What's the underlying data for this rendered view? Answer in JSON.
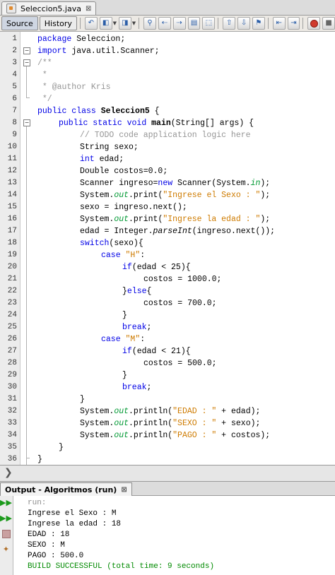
{
  "editor_tab": {
    "title": "Seleccion5.java",
    "close": "⊠"
  },
  "toolbar": {
    "source_label": "Source",
    "history_label": "History"
  },
  "line_numbers": [
    "1",
    "2",
    "3",
    "4",
    "5",
    "6",
    "7",
    "8",
    "9",
    "10",
    "11",
    "12",
    "13",
    "14",
    "15",
    "16",
    "17",
    "18",
    "19",
    "20",
    "21",
    "22",
    "23",
    "24",
    "25",
    "26",
    "27",
    "28",
    "29",
    "30",
    "31",
    "32",
    "33",
    "34",
    "35",
    "36"
  ],
  "code": {
    "l1": {
      "kw": "package",
      "rest": " Seleccion;"
    },
    "l2": {
      "kw": "import",
      "rest": " java.util.Scanner;"
    },
    "l3": "/**",
    "l4": " *",
    "l5": " * @author Kris",
    "l6": " */",
    "l7": {
      "kw": "public class",
      "sp": " ",
      "name": "Seleccion5",
      "rest": " {"
    },
    "l8": {
      "kw": "public static void",
      "sp": " ",
      "name": "main",
      "rest": "(String[] args) {"
    },
    "l9": "// TODO code application logic here",
    "l10": "String sexo;",
    "l11": {
      "kw": "int",
      "rest": " edad;"
    },
    "l12": "Double costos=0.0;",
    "l13": {
      "a": "Scanner ingreso=",
      "kw": "new",
      "b": " Scanner(System.",
      "fld": "in",
      "c": ");"
    },
    "l14": {
      "a": "System.",
      "fld": "out",
      "b": ".print(",
      "str": "\"Ingrese el Sexo : \"",
      "c": ");"
    },
    "l15": "sexo = ingreso.next();",
    "l16": {
      "a": "System.",
      "fld": "out",
      "b": ".print(",
      "str": "\"Ingrese la edad : \"",
      "c": ");"
    },
    "l17": {
      "a": "edad = Integer.",
      "it": "parseInt",
      "b": "(ingreso.next());"
    },
    "l18": {
      "kw": "switch",
      "rest": "(sexo){"
    },
    "l19": {
      "kw": "case",
      "sp": " ",
      "str": "\"H\"",
      "rest": ":"
    },
    "l20": {
      "kw": "if",
      "rest": "(edad < 25){"
    },
    "l21": "costos = 1000.0;",
    "l22": {
      "a": "}",
      "kw": "else",
      "b": "{"
    },
    "l23": "costos = 700.0;",
    "l24": "}",
    "l25": {
      "kw": "break",
      "rest": ";"
    },
    "l26": {
      "kw": "case",
      "sp": " ",
      "str": "\"M\"",
      "rest": ":"
    },
    "l27": {
      "kw": "if",
      "rest": "(edad < 21){"
    },
    "l28": "costos = 500.0;",
    "l29": "}",
    "l30": {
      "kw": "break",
      "rest": ";"
    },
    "l31": "}",
    "l32": {
      "a": "System.",
      "fld": "out",
      "b": ".println(",
      "str": "\"EDAD : \"",
      "c": " + edad);"
    },
    "l33": {
      "a": "System.",
      "fld": "out",
      "b": ".println(",
      "str": "\"SEXO : \"",
      "c": " + sexo);"
    },
    "l34": {
      "a": "System.",
      "fld": "out",
      "b": ".println(",
      "str": "\"PAGO : \"",
      "c": " + costos);"
    },
    "l35": "}",
    "l36": "}"
  },
  "output_panel": {
    "title": "Output - Algoritmos (run)",
    "close": "⊠",
    "lines": [
      "run:",
      "Ingrese el Sexo : M",
      "Ingrese la edad : 18",
      "EDAD : 18",
      "SEXO : M",
      "PAGO : 500.0",
      "BUILD SUCCESSFUL (total time: 9 seconds)"
    ]
  },
  "colors": {
    "keyword": "#0000e6",
    "string": "#ce7b00",
    "comment": "#969696",
    "field": "#009933",
    "build_success": "#008a00"
  },
  "icons": [
    "java-file-icon",
    "close-icon",
    "last-edit-icon",
    "back-icon",
    "forward-icon",
    "find-icon",
    "find-previous-icon",
    "find-next-icon",
    "find-selection-icon",
    "toggle-highlight-icon",
    "toggle-rectangular-icon",
    "previous-bookmark-icon",
    "next-bookmark-icon",
    "toggle-bookmark-icon",
    "shift-left-icon",
    "shift-right-icon",
    "start-macro-icon",
    "stop-macro-icon",
    "navigator-chevron-icon",
    "rerun-icon",
    "rerun-debug-icon",
    "stop-icon",
    "settings-icon"
  ]
}
